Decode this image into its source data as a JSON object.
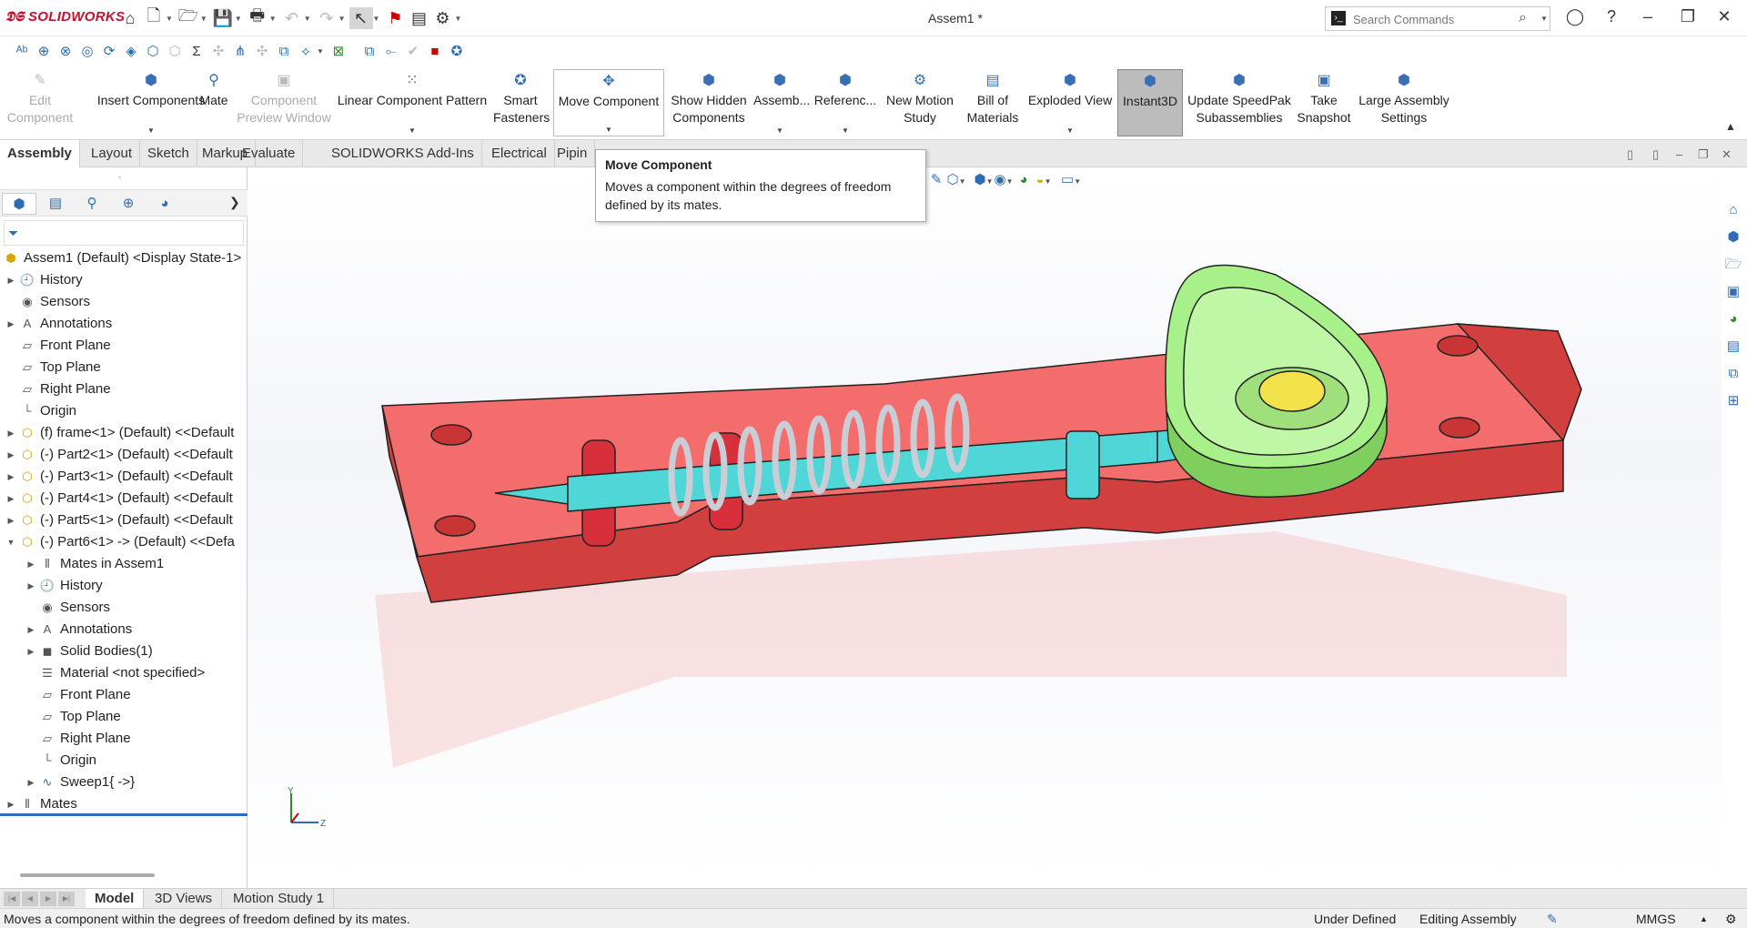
{
  "app": {
    "logo": "SOLIDWORKS",
    "title": "Assem1 *"
  },
  "search": {
    "placeholder": "Search Commands"
  },
  "ribbon": [
    {
      "label": "Edit\nComponent",
      "icon": "edit-component-icon",
      "state": "disabled"
    },
    {
      "label": "Insert Components",
      "icon": "insert-components-icon",
      "state": "normal"
    },
    {
      "label": "Mate",
      "icon": "mate-icon",
      "state": "normal"
    },
    {
      "label": "Component\nPreview Window",
      "icon": "preview-window-icon",
      "state": "disabled"
    },
    {
      "label": "Linear Component Pattern",
      "icon": "linear-pattern-icon",
      "state": "normal"
    },
    {
      "label": "Smart\nFasteners",
      "icon": "smart-fasteners-icon",
      "state": "normal"
    },
    {
      "label": "Move Component",
      "icon": "move-component-icon",
      "state": "hover"
    },
    {
      "label": "Show Hidden\nComponents",
      "icon": "show-hidden-icon",
      "state": "normal"
    },
    {
      "label": "Assemb...",
      "icon": "assembly-features-icon",
      "state": "normal"
    },
    {
      "label": "Referenc...",
      "icon": "reference-geometry-icon",
      "state": "normal"
    },
    {
      "label": "New Motion\nStudy",
      "icon": "motion-study-icon",
      "state": "normal"
    },
    {
      "label": "Bill of\nMaterials",
      "icon": "bom-icon",
      "state": "normal"
    },
    {
      "label": "Exploded View",
      "icon": "exploded-view-icon",
      "state": "normal"
    },
    {
      "label": "Instant3D",
      "icon": "instant3d-icon",
      "state": "active"
    },
    {
      "label": "Update SpeedPak\nSubassemblies",
      "icon": "speedpak-icon",
      "state": "normal"
    },
    {
      "label": "Take\nSnapshot",
      "icon": "snapshot-icon",
      "state": "normal"
    },
    {
      "label": "Large Assembly\nSettings",
      "icon": "large-assembly-icon",
      "state": "normal"
    }
  ],
  "tabs": [
    "Assembly",
    "Layout",
    "Sketch",
    "Markup",
    "Evaluate",
    "SOLIDWORKS Add-Ins",
    "Electrical",
    "Pipin"
  ],
  "active_tab": "Assembly",
  "tooltip": {
    "title": "Move Component",
    "description": "Moves a component within the degrees of freedom defined by its mates."
  },
  "tree": [
    {
      "label": "Assem1 (Default) <Display State-1>",
      "icon": "assembly-icon",
      "depth": 0,
      "toggle": ""
    },
    {
      "label": "History",
      "icon": "history-icon",
      "depth": 0,
      "toggle": "▶"
    },
    {
      "label": "Sensors",
      "icon": "sensors-icon",
      "depth": 0,
      "toggle": ""
    },
    {
      "label": "Annotations",
      "icon": "annotations-icon",
      "depth": 0,
      "toggle": "▶"
    },
    {
      "label": "Front Plane",
      "icon": "plane-icon",
      "depth": 0,
      "toggle": ""
    },
    {
      "label": "Top Plane",
      "icon": "plane-icon",
      "depth": 0,
      "toggle": ""
    },
    {
      "label": "Right Plane",
      "icon": "plane-icon",
      "depth": 0,
      "toggle": ""
    },
    {
      "label": "Origin",
      "icon": "origin-icon",
      "depth": 0,
      "toggle": ""
    },
    {
      "label": "(f) frame<1> (Default) <<Default",
      "icon": "part-icon",
      "depth": 0,
      "toggle": "▶"
    },
    {
      "label": "(-) Part2<1> (Default) <<Default",
      "icon": "part-icon",
      "depth": 0,
      "toggle": "▶"
    },
    {
      "label": "(-) Part3<1> (Default) <<Default",
      "icon": "part-icon",
      "depth": 0,
      "toggle": "▶"
    },
    {
      "label": "(-) Part4<1> (Default) <<Default",
      "icon": "part-icon",
      "depth": 0,
      "toggle": "▶"
    },
    {
      "label": "(-) Part5<1> (Default) <<Default",
      "icon": "part-icon",
      "depth": 0,
      "toggle": "▶"
    },
    {
      "label": "(-) Part6<1> -> (Default) <<Defa",
      "icon": "part-icon",
      "depth": 0,
      "toggle": "▼"
    },
    {
      "label": "Mates in Assem1",
      "icon": "mates-icon",
      "depth": 1,
      "toggle": "▶"
    },
    {
      "label": "History",
      "icon": "history-icon",
      "depth": 1,
      "toggle": "▶"
    },
    {
      "label": "Sensors",
      "icon": "sensors-icon",
      "depth": 1,
      "toggle": ""
    },
    {
      "label": "Annotations",
      "icon": "annotations-icon",
      "depth": 1,
      "toggle": "▶"
    },
    {
      "label": "Solid Bodies(1)",
      "icon": "solid-bodies-icon",
      "depth": 1,
      "toggle": "▶"
    },
    {
      "label": "Material <not specified>",
      "icon": "material-icon",
      "depth": 1,
      "toggle": ""
    },
    {
      "label": "Front Plane",
      "icon": "plane-icon",
      "depth": 1,
      "toggle": ""
    },
    {
      "label": "Top Plane",
      "icon": "plane-icon",
      "depth": 1,
      "toggle": ""
    },
    {
      "label": "Right Plane",
      "icon": "plane-icon",
      "depth": 1,
      "toggle": ""
    },
    {
      "label": "Origin",
      "icon": "origin-icon",
      "depth": 1,
      "toggle": ""
    },
    {
      "label": "Sweep1{ ->}",
      "icon": "sweep-icon",
      "depth": 1,
      "toggle": "▶"
    },
    {
      "label": "Mates",
      "icon": "mates-icon",
      "depth": 0,
      "toggle": "▶"
    }
  ],
  "bottom_tabs": [
    "Model",
    "3D Views",
    "Motion Study 1"
  ],
  "active_bottom_tab": "Model",
  "status": {
    "message": "Moves a component within the degrees of freedom defined by its mates.",
    "definition": "Under Defined",
    "mode": "Editing Assembly",
    "units": "MMGS"
  },
  "triad": {
    "y": "Y",
    "z": "Z"
  },
  "colors": {
    "frame": "#f46d6d",
    "cam": "#a8f08a",
    "shaft": "#4fd6d6",
    "spring": "#c9ced6",
    "knob": "#f3e34a",
    "accent": "#2f6db3"
  }
}
